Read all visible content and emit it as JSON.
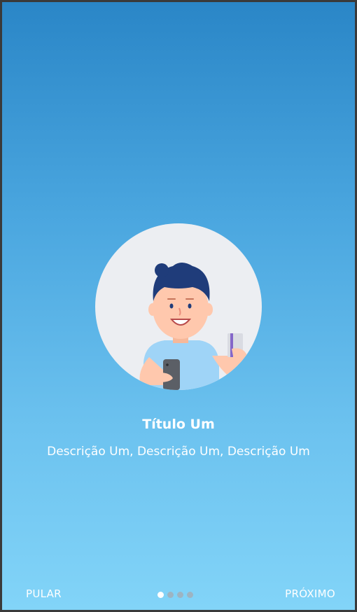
{
  "onboarding": {
    "illustration": "person-with-phone-and-card-illustration",
    "title": "Título Um",
    "description": "Descrição Um, Descrição Um, Descrição Um"
  },
  "footer": {
    "skip_label": "PULAR",
    "next_label": "PRÓXIMO",
    "page_indicator": {
      "total": 4,
      "active": 1
    }
  },
  "colors": {
    "gradient_top": "#2a86c7",
    "gradient_bottom": "#82d4f8",
    "text": "#ffffff",
    "dot_inactive": "#9db4c2",
    "dot_active": "#ffffff"
  }
}
